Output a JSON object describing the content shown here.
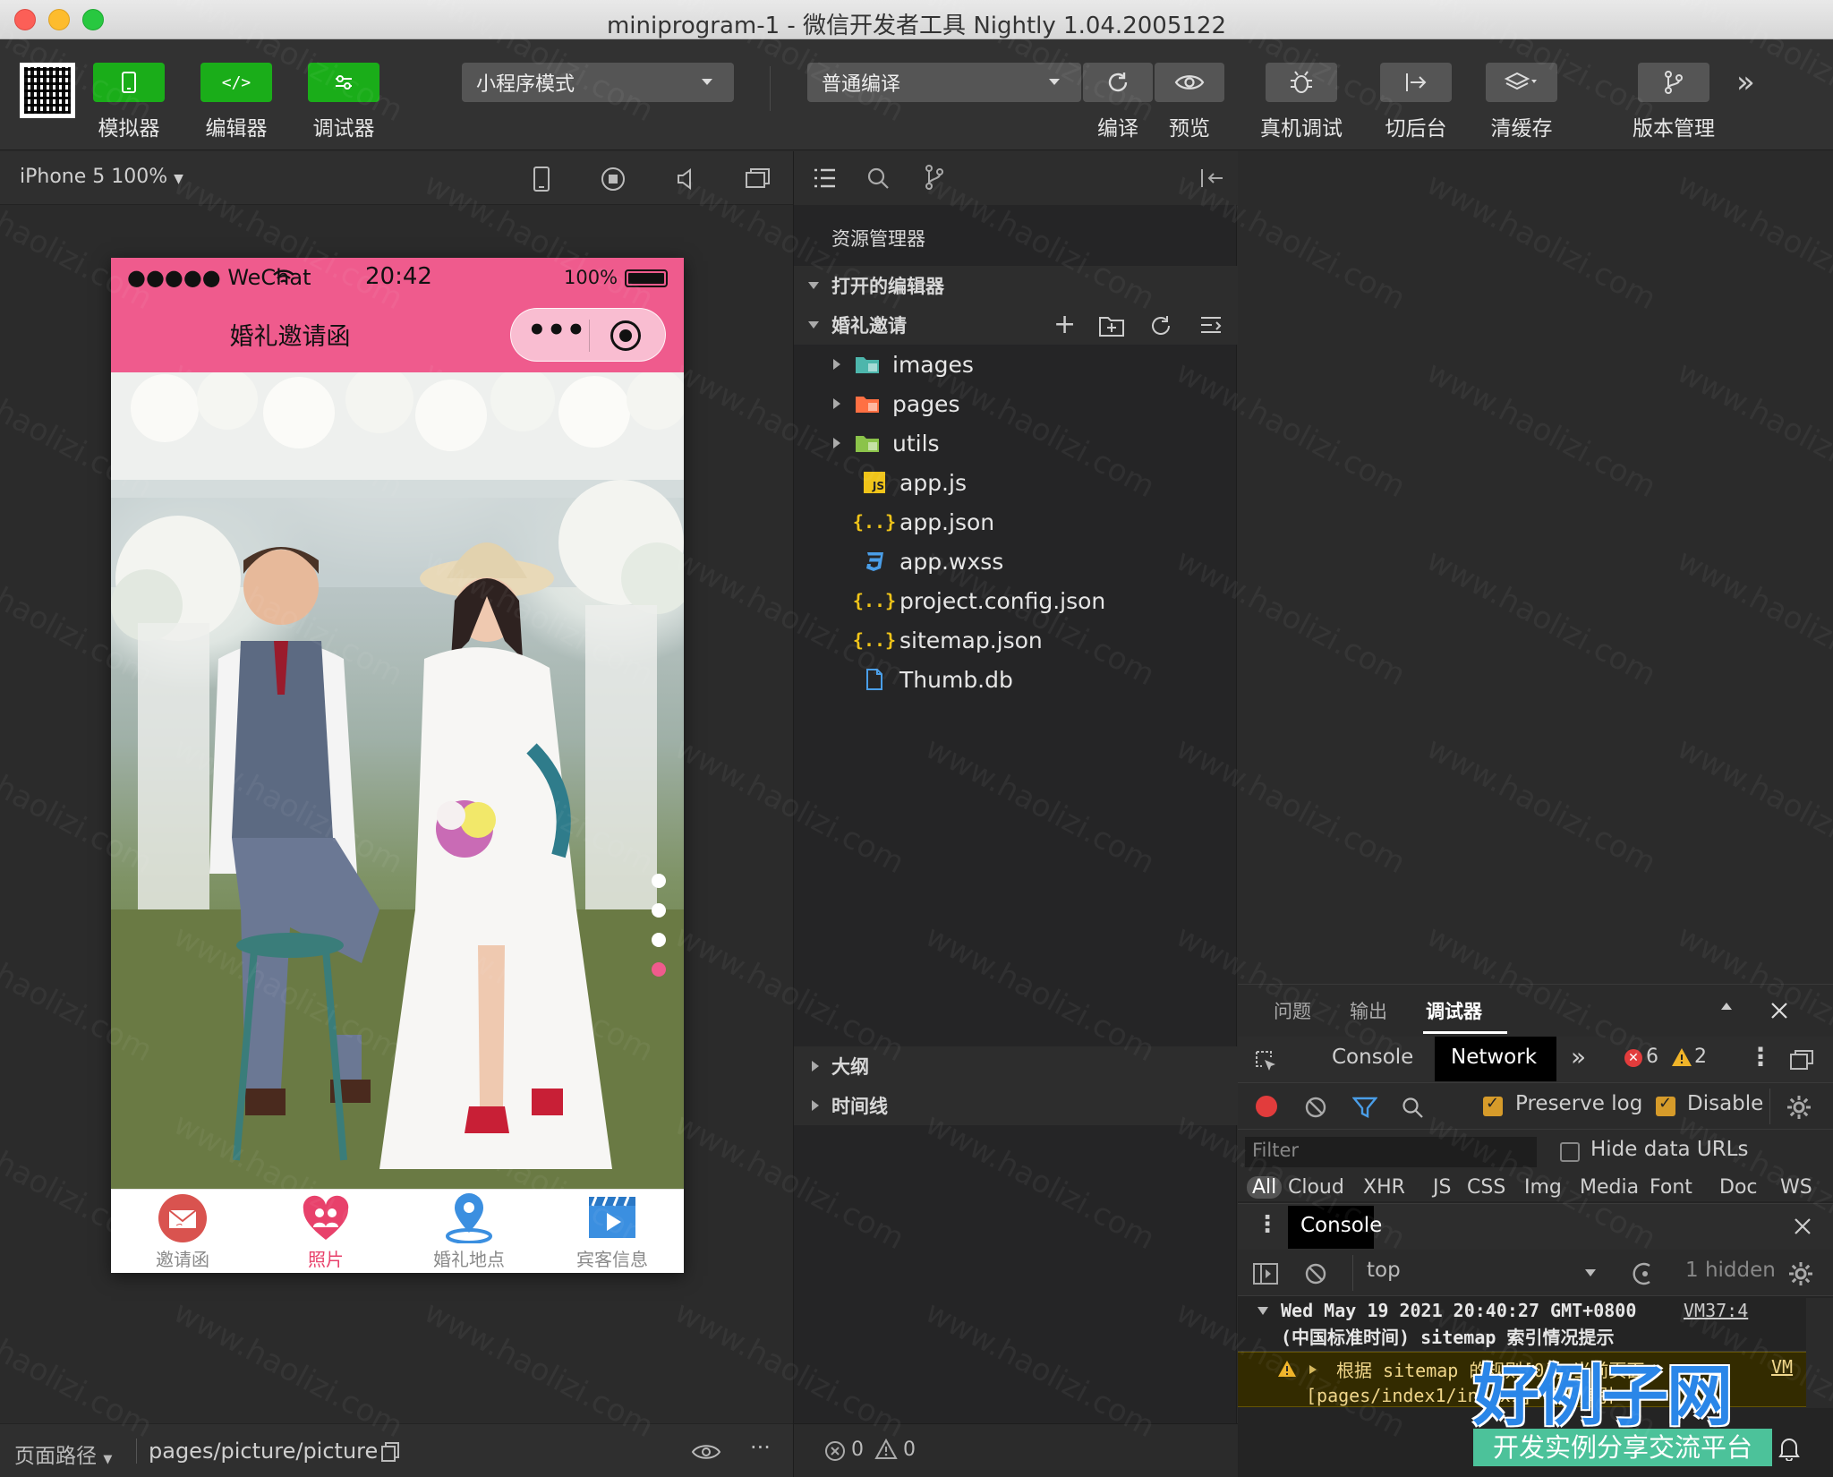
{
  "window": {
    "title": "miniprogram-1 - 微信开发者工具 Nightly 1.04.2005122"
  },
  "toolbar": {
    "simulator_label": "模拟器",
    "editor_label": "编辑器",
    "debugger_label": "调试器",
    "mode_select": "小程序模式",
    "compile_select": "普通编译",
    "compile_label": "编译",
    "preview_label": "预览",
    "remote_debug_label": "真机调试",
    "background_label": "切后台",
    "clear_cache_label": "清缓存",
    "version_label": "版本管理",
    "more_icon": "»"
  },
  "simulator": {
    "device_select": "iPhone 5 100%",
    "status": {
      "carrier": "●●●●● WeChat",
      "time": "20:42",
      "battery": "100%"
    },
    "nav_title": "婚礼邀请函",
    "capsule_more": "•••",
    "tabs": [
      {
        "label": "邀请函",
        "icon": "mail-icon",
        "color": "#d9534f",
        "active": false
      },
      {
        "label": "照片",
        "icon": "heart-people-icon",
        "color": "#e8416b",
        "active": true
      },
      {
        "label": "婚礼地点",
        "icon": "location-pin-icon",
        "color": "#3b8fe0",
        "active": false
      },
      {
        "label": "宾客信息",
        "icon": "video-play-icon",
        "color": "#3b8fe0",
        "active": false
      }
    ],
    "swiper_dots": 4,
    "swiper_active": 4,
    "footer_path_label": "页面路径",
    "footer_path": "pages/picture/picture",
    "footer_more": "···"
  },
  "explorer": {
    "title": "资源管理器",
    "open_editors": "打开的编辑器",
    "project": "婚礼邀请",
    "files": [
      {
        "name": "images",
        "type": "folder",
        "color": "#4db6ac"
      },
      {
        "name": "pages",
        "type": "folder",
        "color": "#ff7043"
      },
      {
        "name": "utils",
        "type": "folder",
        "color": "#8bc34a"
      },
      {
        "name": "app.js",
        "type": "js"
      },
      {
        "name": "app.json",
        "type": "json"
      },
      {
        "name": "app.wxss",
        "type": "css"
      },
      {
        "name": "project.config.json",
        "type": "json"
      },
      {
        "name": "sitemap.json",
        "type": "json"
      },
      {
        "name": "Thumb.db",
        "type": "file"
      }
    ],
    "outline": "大纲",
    "timeline": "时间线",
    "errors": "0",
    "warnings": "0"
  },
  "devtools": {
    "tabs": [
      "问题",
      "输出",
      "调试器"
    ],
    "active_tab": "调试器",
    "panel_tabs": [
      "Console",
      "Network"
    ],
    "active_panel": "Network",
    "error_count": "6",
    "warning_count": "2",
    "preserve_log": "Preserve log",
    "disable_cache": "Disable",
    "filter_placeholder": "Filter",
    "hide_data_urls": "Hide data URLs",
    "types": [
      "All",
      "Cloud",
      "XHR",
      "JS",
      "CSS",
      "Img",
      "Media",
      "Font",
      "Doc",
      "WS"
    ],
    "drawer_tab": "Console",
    "context": "top",
    "hidden": "1 hidden",
    "log": {
      "line1": "Wed May 19 2021 20:40:27 GMT+0800",
      "source": "VM37:4",
      "line2": "(中国标准时间) sitemap 索引情况提示",
      "warn1": "根据 sitemap 的规则[0]，当前页面",
      "warn_source": "VM",
      "warn2": "[pages/index1/index1] 将被索引"
    }
  },
  "watermark": {
    "logo": "好例子网",
    "tagline": "开发实例分享交流平台",
    "pattern": "www.haolizi.com"
  }
}
